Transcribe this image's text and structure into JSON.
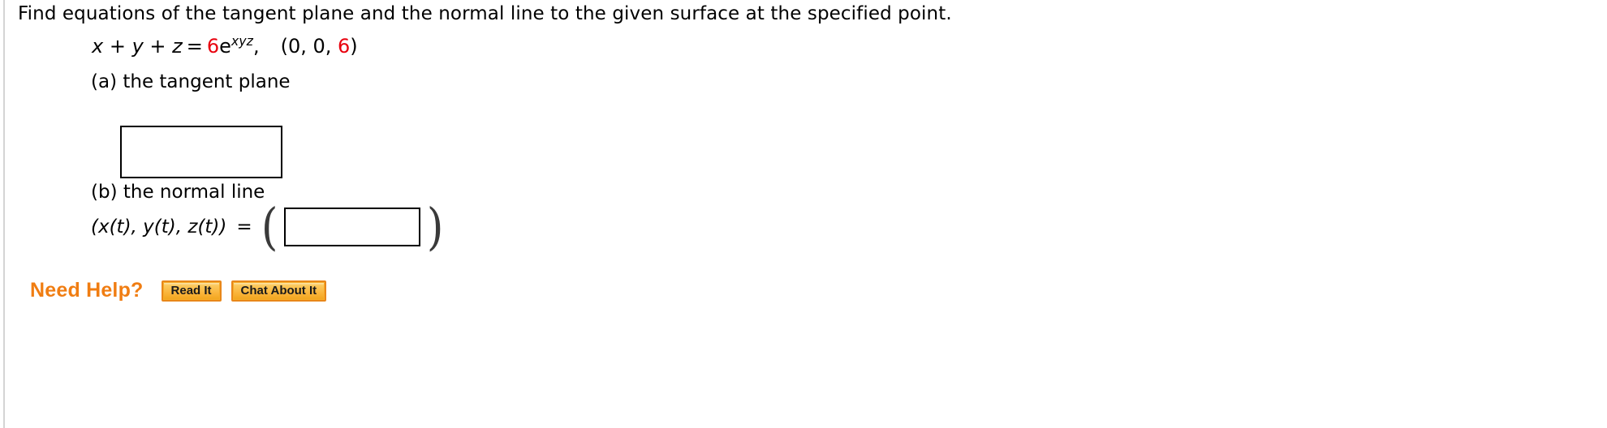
{
  "problem": {
    "prompt": "Find equations of the tangent plane and the normal line to the given surface at the specified point.",
    "equation": {
      "lhs": "x + y + z",
      "equals": "=",
      "rhs_coefficient": "6",
      "rhs_base": "e",
      "rhs_exponent": "xyz",
      "comma": ",",
      "point": "(0, 0, 6)",
      "point_prefix": "(0, 0, ",
      "point_highlight": "6",
      "point_suffix": ")",
      "highlight_color": "#e8000d"
    }
  },
  "parts": {
    "a": {
      "label": "(a) the tangent plane",
      "answer_value": "",
      "answer_placeholder": ""
    },
    "b": {
      "label": "(b) the normal line",
      "expression": "(x(t), y(t), z(t))",
      "equals": "=",
      "open_paren": "(",
      "close_paren": ")",
      "answer_value": "",
      "answer_placeholder": ""
    }
  },
  "need_help": {
    "label": "Need Help?",
    "buttons": [
      {
        "label": "Read It"
      },
      {
        "label": "Chat About It"
      }
    ],
    "accent_color": "#f07d12"
  }
}
